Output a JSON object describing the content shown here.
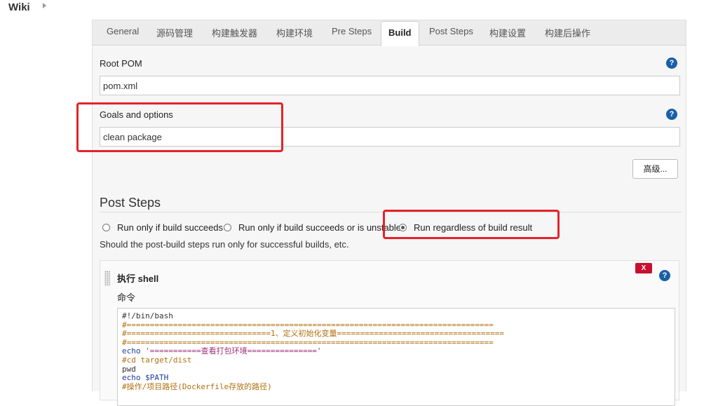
{
  "breadcrumb": {
    "label": "Wiki"
  },
  "tabs": [
    "General",
    "源码管理",
    "构建触发器",
    "构建环境",
    "Pre Steps",
    "Build",
    "Post Steps",
    "构建设置",
    "构建后操作"
  ],
  "active_tab": "Build",
  "root_pom": {
    "label": "Root POM",
    "value": "pom.xml"
  },
  "goals": {
    "label": "Goals and options",
    "value": "clean package"
  },
  "help_glyph": "?",
  "advanced_button": "高级...",
  "post_steps": {
    "title": "Post Steps",
    "options": [
      {
        "label": "Run only if build succeeds",
        "checked": false
      },
      {
        "label": "Run only if build succeeds or is unstable",
        "checked": false
      },
      {
        "label": "Run regardless of build result",
        "checked": true
      }
    ],
    "hint": "Should the post-build steps run only for successful builds, etc."
  },
  "shell_step": {
    "title": "执行 shell",
    "delete_label": "X",
    "command_label": "命令",
    "code": {
      "line1": "#!/bin/bash",
      "line2": "#===============================================================================",
      "line3": "#===============================1、定义初始化变量====================================",
      "line4": "#===============================================================================",
      "line5_cmd": "echo ",
      "line5_str": "'===========查看打包环境==============='",
      "line6": "#cd target/dist",
      "line7": "pwd",
      "line8": "echo $PATH",
      "line9": "#操作/项目路径(Dockerfile存放的路径)"
    }
  },
  "colors": {
    "highlight": "#e3242b",
    "help": "#1a5fa8",
    "delete": "#c8102e"
  }
}
